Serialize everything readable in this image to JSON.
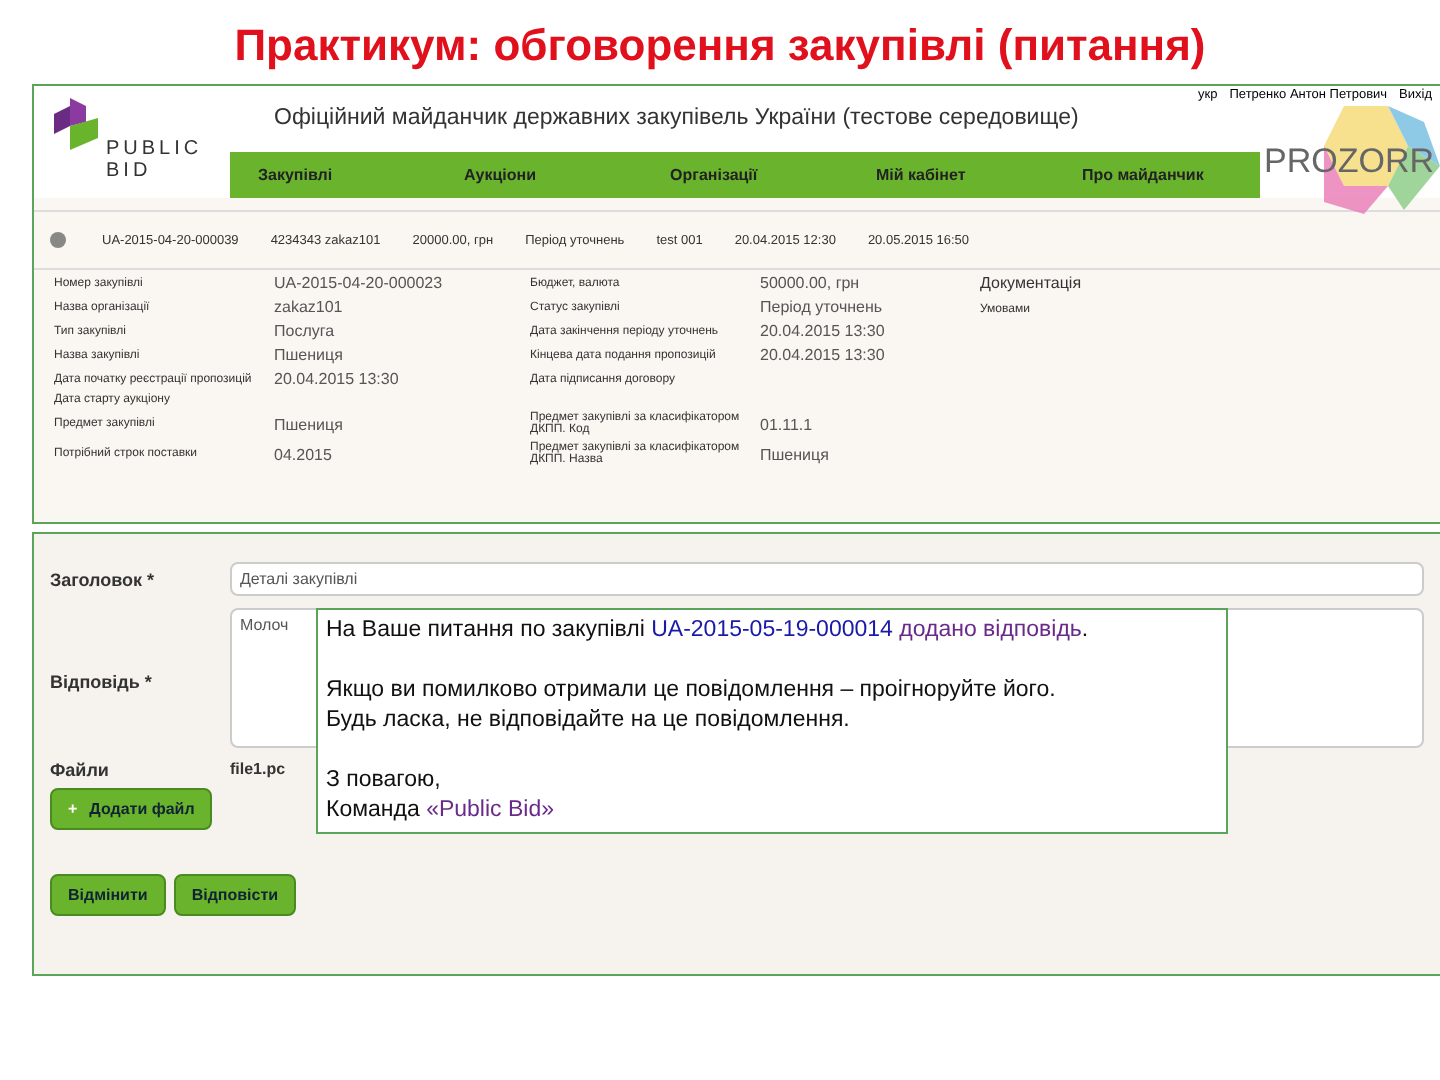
{
  "slide_title": "Практикум: обговорення закупівлі (питання)",
  "site": {
    "logo_words": [
      "PUBLIC",
      "BID"
    ],
    "title": "Офіційний майданчик державних закупівель України (тестове середовище)",
    "language": "укр",
    "user": "Петренко Антон Петрович",
    "logout": "Вихід",
    "partner_logo": "PROZORR"
  },
  "nav": [
    "Закупівлі",
    "Аукціони",
    "Організації",
    "Мій кабінет",
    "Про майданчик"
  ],
  "summary_row": [
    "UA-2015-04-20-000039",
    "4234343 zakaz101",
    "20000.00, грн",
    "Період уточнень",
    "test 001",
    "20.04.2015 12:30",
    "20.05.2015 16:50"
  ],
  "details": [
    {
      "label": "Номер закупівлі",
      "value": "UA-2015-04-20-000023",
      "label_2": "Бюджет, валюта",
      "value_2": "50000.00, грн"
    },
    {
      "label": "Назва організації",
      "value": "zakaz101",
      "label_2": "Статус закупівлі",
      "value_2": "Період уточнень"
    },
    {
      "label": "Тип закупівлі",
      "value": "Послуга",
      "label_2": "Дата закінчення періоду уточнень",
      "value_2": "20.04.2015 13:30"
    },
    {
      "label": "Назва закупівлі",
      "value": "Пшениця",
      "label_2": "Кінцева дата подання пропозицій",
      "value_2": "20.04.2015 13:30"
    },
    {
      "label": "Дата початку реєстрації пропозицій",
      "value": "20.04.2015 13:30",
      "label_2": "Дата підписання договору"
    },
    {
      "label": "Дата старту аукціону"
    },
    {
      "label": "Предмет закупівлі",
      "value": "Пшениця",
      "label_2": "Предмет закупівлі за класифікатором ДКПП. Код",
      "value_2": "01.11.1"
    },
    {
      "label": "Потрібний строк поставки",
      "value": "04.2015",
      "label_2": "Предмет закупівлі за класифікатором ДКПП. Назва",
      "value_2": "Пшениця"
    }
  ],
  "documents": {
    "title": "Документація",
    "note": "Умовами"
  },
  "form": {
    "fields": [
      {
        "kind": "input",
        "label": "Заголовок *",
        "value": "Деталі закупівлі"
      },
      {
        "kind": "textarea",
        "label": "Відповідь *",
        "value": "Молоч"
      }
    ],
    "files_label": "Файли",
    "file": "file1.pc",
    "add_icon": "+",
    "add_file": "Додати файл",
    "buttons": [
      "Відмінити",
      "Відповісти"
    ]
  },
  "email": {
    "line_start": "На Ваше питання по закупівлі",
    "tender_link": "UA-2015-05-19-000014",
    "answer_link": "додано відповідь",
    "line_end": ".",
    "notice": [
      "Якщо ви помилково отримали це повідомлення – проігноруйте його.",
      "Будь ласка, не відповідайте на це повідомлення."
    ],
    "closing": "З повагою,",
    "team": "Команда",
    "team_link": "«Public Bid»"
  }
}
